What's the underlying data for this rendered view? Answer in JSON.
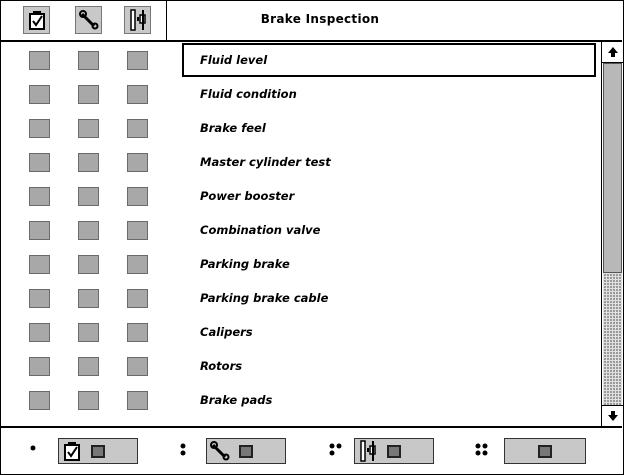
{
  "header": {
    "title": "Brake Inspection",
    "icons": [
      "checklist-icon",
      "wrench-icon",
      "parts-icon"
    ]
  },
  "items": [
    {
      "label": "Fluid level",
      "selected": true
    },
    {
      "label": "Fluid condition"
    },
    {
      "label": "Brake feel"
    },
    {
      "label": "Master cylinder test"
    },
    {
      "label": "Power booster"
    },
    {
      "label": "Combination valve"
    },
    {
      "label": "Parking brake"
    },
    {
      "label": "Parking brake cable"
    },
    {
      "label": "Calipers"
    },
    {
      "label": "Rotors"
    },
    {
      "label": "Brake pads"
    }
  ],
  "scrollbar": {
    "up_icon": "arrow-up-icon",
    "down_icon": "arrow-down-icon"
  },
  "footer": {
    "filters": [
      {
        "dots": "•",
        "icon": "checklist-icon"
      },
      {
        "dots": "⁚",
        "icon": "wrench-icon"
      },
      {
        "dots": "⁖",
        "icon": "parts-icon"
      },
      {
        "dots": "⁘",
        "icon": "none"
      }
    ]
  }
}
